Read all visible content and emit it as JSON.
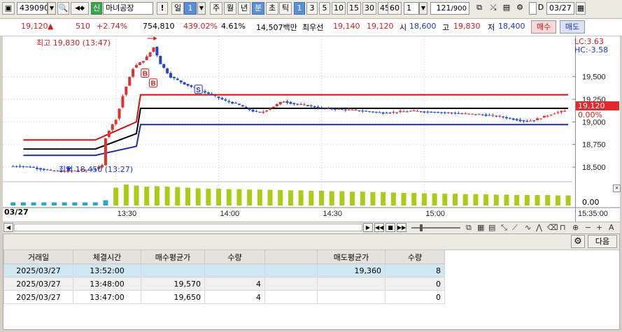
{
  "toolbar": {
    "code": "439090",
    "credit_badge": "신",
    "stock_name": "마녀공장",
    "warn_label": "!",
    "period_day": "일",
    "period_day_n": "1",
    "period_week": "주",
    "period_month": "월",
    "period_year": "년",
    "period_minute": "분",
    "period_second": "초",
    "period_tick": "틱",
    "intervals": [
      "1",
      "3",
      "5",
      "10",
      "15",
      "30",
      "45",
      "60"
    ],
    "interval_selected": "1",
    "multiplier": "1",
    "count_current": "121",
    "count_total": "/900",
    "date_checkbox_label": "D",
    "date_value": "03/27"
  },
  "info": {
    "price": "19,120",
    "arrow": "▲",
    "change": "510",
    "change_pct": "+2.74%",
    "volume": "754,810",
    "volume_ratio": "439.02%",
    "turnover_pct": "4.61%",
    "amount": "14,507백만",
    "best_ask_label": "최우선",
    "best_ask": "19,140",
    "best_bid": "19,120",
    "open_label": "시",
    "open": "18,600",
    "high_label": "고",
    "high": "19,830",
    "low_label": "저",
    "low": "18,400",
    "buy_button": "매수",
    "sell_button": "매도"
  },
  "chart_data": {
    "type": "candlestick",
    "date_label": "03/27",
    "x_ticks": [
      "13:30",
      "14:00",
      "14:30",
      "15:00",
      "15:35:00"
    ],
    "y_ticks": [
      19500,
      19250,
      19000,
      18750,
      18500
    ],
    "ylim": [
      18400,
      19830
    ],
    "volume_tick": "0.00",
    "price_tag": "19,120",
    "pct_tag": "0.00%",
    "lc_label": "LC:3.63",
    "hc_label": "HC:-3.58",
    "high_annotation": "최고 19,830 (13:47)",
    "low_annotation": "최저 18,450 (13:27)",
    "markers": [
      "B",
      "B",
      "S"
    ],
    "colors": {
      "up": "#e0302f",
      "down": "#2346c8",
      "upper_band": "#d60d0d",
      "middle_band": "#000000",
      "lower_band": "#1c2f9e",
      "volume": "#a8cc17"
    },
    "bands": {
      "upper": [
        [
          13.05,
          18800
        ],
        [
          13.4,
          18800
        ],
        [
          13.6,
          19000
        ],
        [
          13.62,
          19300
        ],
        [
          15.7,
          19300
        ]
      ],
      "middle": [
        [
          13.05,
          18700
        ],
        [
          13.4,
          18700
        ],
        [
          13.6,
          18870
        ],
        [
          13.62,
          19150
        ],
        [
          15.7,
          19150
        ]
      ],
      "lower": [
        [
          13.05,
          18630
        ],
        [
          13.4,
          18630
        ],
        [
          13.6,
          18730
        ],
        [
          13.62,
          18970
        ],
        [
          15.7,
          18970
        ]
      ]
    },
    "price_path": [
      [
        13.0,
        18510
      ],
      [
        13.05,
        18510
      ],
      [
        13.1,
        18500
      ],
      [
        13.15,
        18480
      ],
      [
        13.2,
        18460
      ],
      [
        13.27,
        18450
      ],
      [
        13.3,
        18460
      ],
      [
        13.38,
        18470
      ],
      [
        13.42,
        18480
      ],
      [
        13.45,
        18520
      ],
      [
        13.46,
        18800
      ],
      [
        13.48,
        18900
      ],
      [
        13.52,
        19050
      ],
      [
        13.55,
        19300
      ],
      [
        13.6,
        19600
      ],
      [
        13.66,
        19700
      ],
      [
        13.7,
        19830
      ],
      [
        13.73,
        19650
      ],
      [
        13.78,
        19500
      ],
      [
        13.85,
        19420
      ],
      [
        13.92,
        19350
      ],
      [
        13.98,
        19300
      ],
      [
        14.05,
        19230
      ],
      [
        14.1,
        19200
      ],
      [
        14.18,
        19120
      ],
      [
        14.22,
        19100
      ],
      [
        14.28,
        19170
      ],
      [
        14.33,
        19230
      ],
      [
        14.38,
        19200
      ],
      [
        14.45,
        19180
      ],
      [
        14.52,
        19150
      ],
      [
        14.6,
        19140
      ],
      [
        14.72,
        19120
      ],
      [
        14.82,
        19100
      ],
      [
        14.95,
        19120
      ],
      [
        15.05,
        19110
      ],
      [
        15.15,
        19100
      ],
      [
        15.2,
        19090
      ],
      [
        15.3,
        19080
      ],
      [
        15.38,
        19060
      ],
      [
        15.45,
        19030
      ],
      [
        15.5,
        19010
      ],
      [
        15.55,
        19020
      ],
      [
        15.6,
        19060
      ],
      [
        15.65,
        19100
      ],
      [
        15.7,
        19120
      ]
    ],
    "volume": [
      [
        13.0,
        0.15
      ],
      [
        13.05,
        0.15
      ],
      [
        13.1,
        0.15
      ],
      [
        13.15,
        0.15
      ],
      [
        13.2,
        0.15
      ],
      [
        13.25,
        0.15
      ],
      [
        13.3,
        0.15
      ],
      [
        13.35,
        0.15
      ],
      [
        13.4,
        0.15
      ],
      [
        13.45,
        0.25
      ],
      [
        13.5,
        0.85
      ],
      [
        13.55,
        1.0
      ],
      [
        13.6,
        0.95
      ],
      [
        13.65,
        0.9
      ],
      [
        13.7,
        0.92
      ],
      [
        13.75,
        0.9
      ],
      [
        13.8,
        0.88
      ],
      [
        13.85,
        0.85
      ],
      [
        13.9,
        0.82
      ],
      [
        13.95,
        0.8
      ],
      [
        14.0,
        0.8
      ],
      [
        14.05,
        0.78
      ],
      [
        14.1,
        0.78
      ],
      [
        14.15,
        0.76
      ],
      [
        14.2,
        0.76
      ],
      [
        14.25,
        0.75
      ],
      [
        14.3,
        0.74
      ],
      [
        14.35,
        0.72
      ],
      [
        14.4,
        0.72
      ],
      [
        14.45,
        0.7
      ],
      [
        14.5,
        0.7
      ],
      [
        14.55,
        0.68
      ],
      [
        14.6,
        0.68
      ],
      [
        14.65,
        0.66
      ],
      [
        14.7,
        0.66
      ],
      [
        14.75,
        0.64
      ],
      [
        14.8,
        0.64
      ],
      [
        14.85,
        0.62
      ],
      [
        14.9,
        0.6
      ],
      [
        14.95,
        0.6
      ],
      [
        15.0,
        0.58
      ],
      [
        15.05,
        0.58
      ],
      [
        15.1,
        0.56
      ],
      [
        15.15,
        0.56
      ],
      [
        15.2,
        0.54
      ],
      [
        15.25,
        0.54
      ],
      [
        15.3,
        0.53
      ],
      [
        15.35,
        0.52
      ],
      [
        15.4,
        0.52
      ],
      [
        15.45,
        0.5
      ],
      [
        15.5,
        0.5
      ],
      [
        15.55,
        0.5
      ],
      [
        15.6,
        0.5
      ],
      [
        15.65,
        0.48
      ],
      [
        15.7,
        0.48
      ]
    ]
  },
  "bottom": {
    "next_button": "다음"
  },
  "table": {
    "headers": [
      "거래일",
      "체결시간",
      "매수평균가",
      "수량",
      "",
      "매도평균가",
      "수량"
    ],
    "rows": [
      [
        "2025/03/27",
        "13:52:00",
        "",
        "",
        "",
        "19,360",
        "8"
      ],
      [
        "2025/03/27",
        "13:48:00",
        "19,570",
        "4",
        "",
        "",
        "0"
      ],
      [
        "2025/03/27",
        "13:47:00",
        "19,650",
        "4",
        "",
        "",
        "0"
      ]
    ]
  }
}
